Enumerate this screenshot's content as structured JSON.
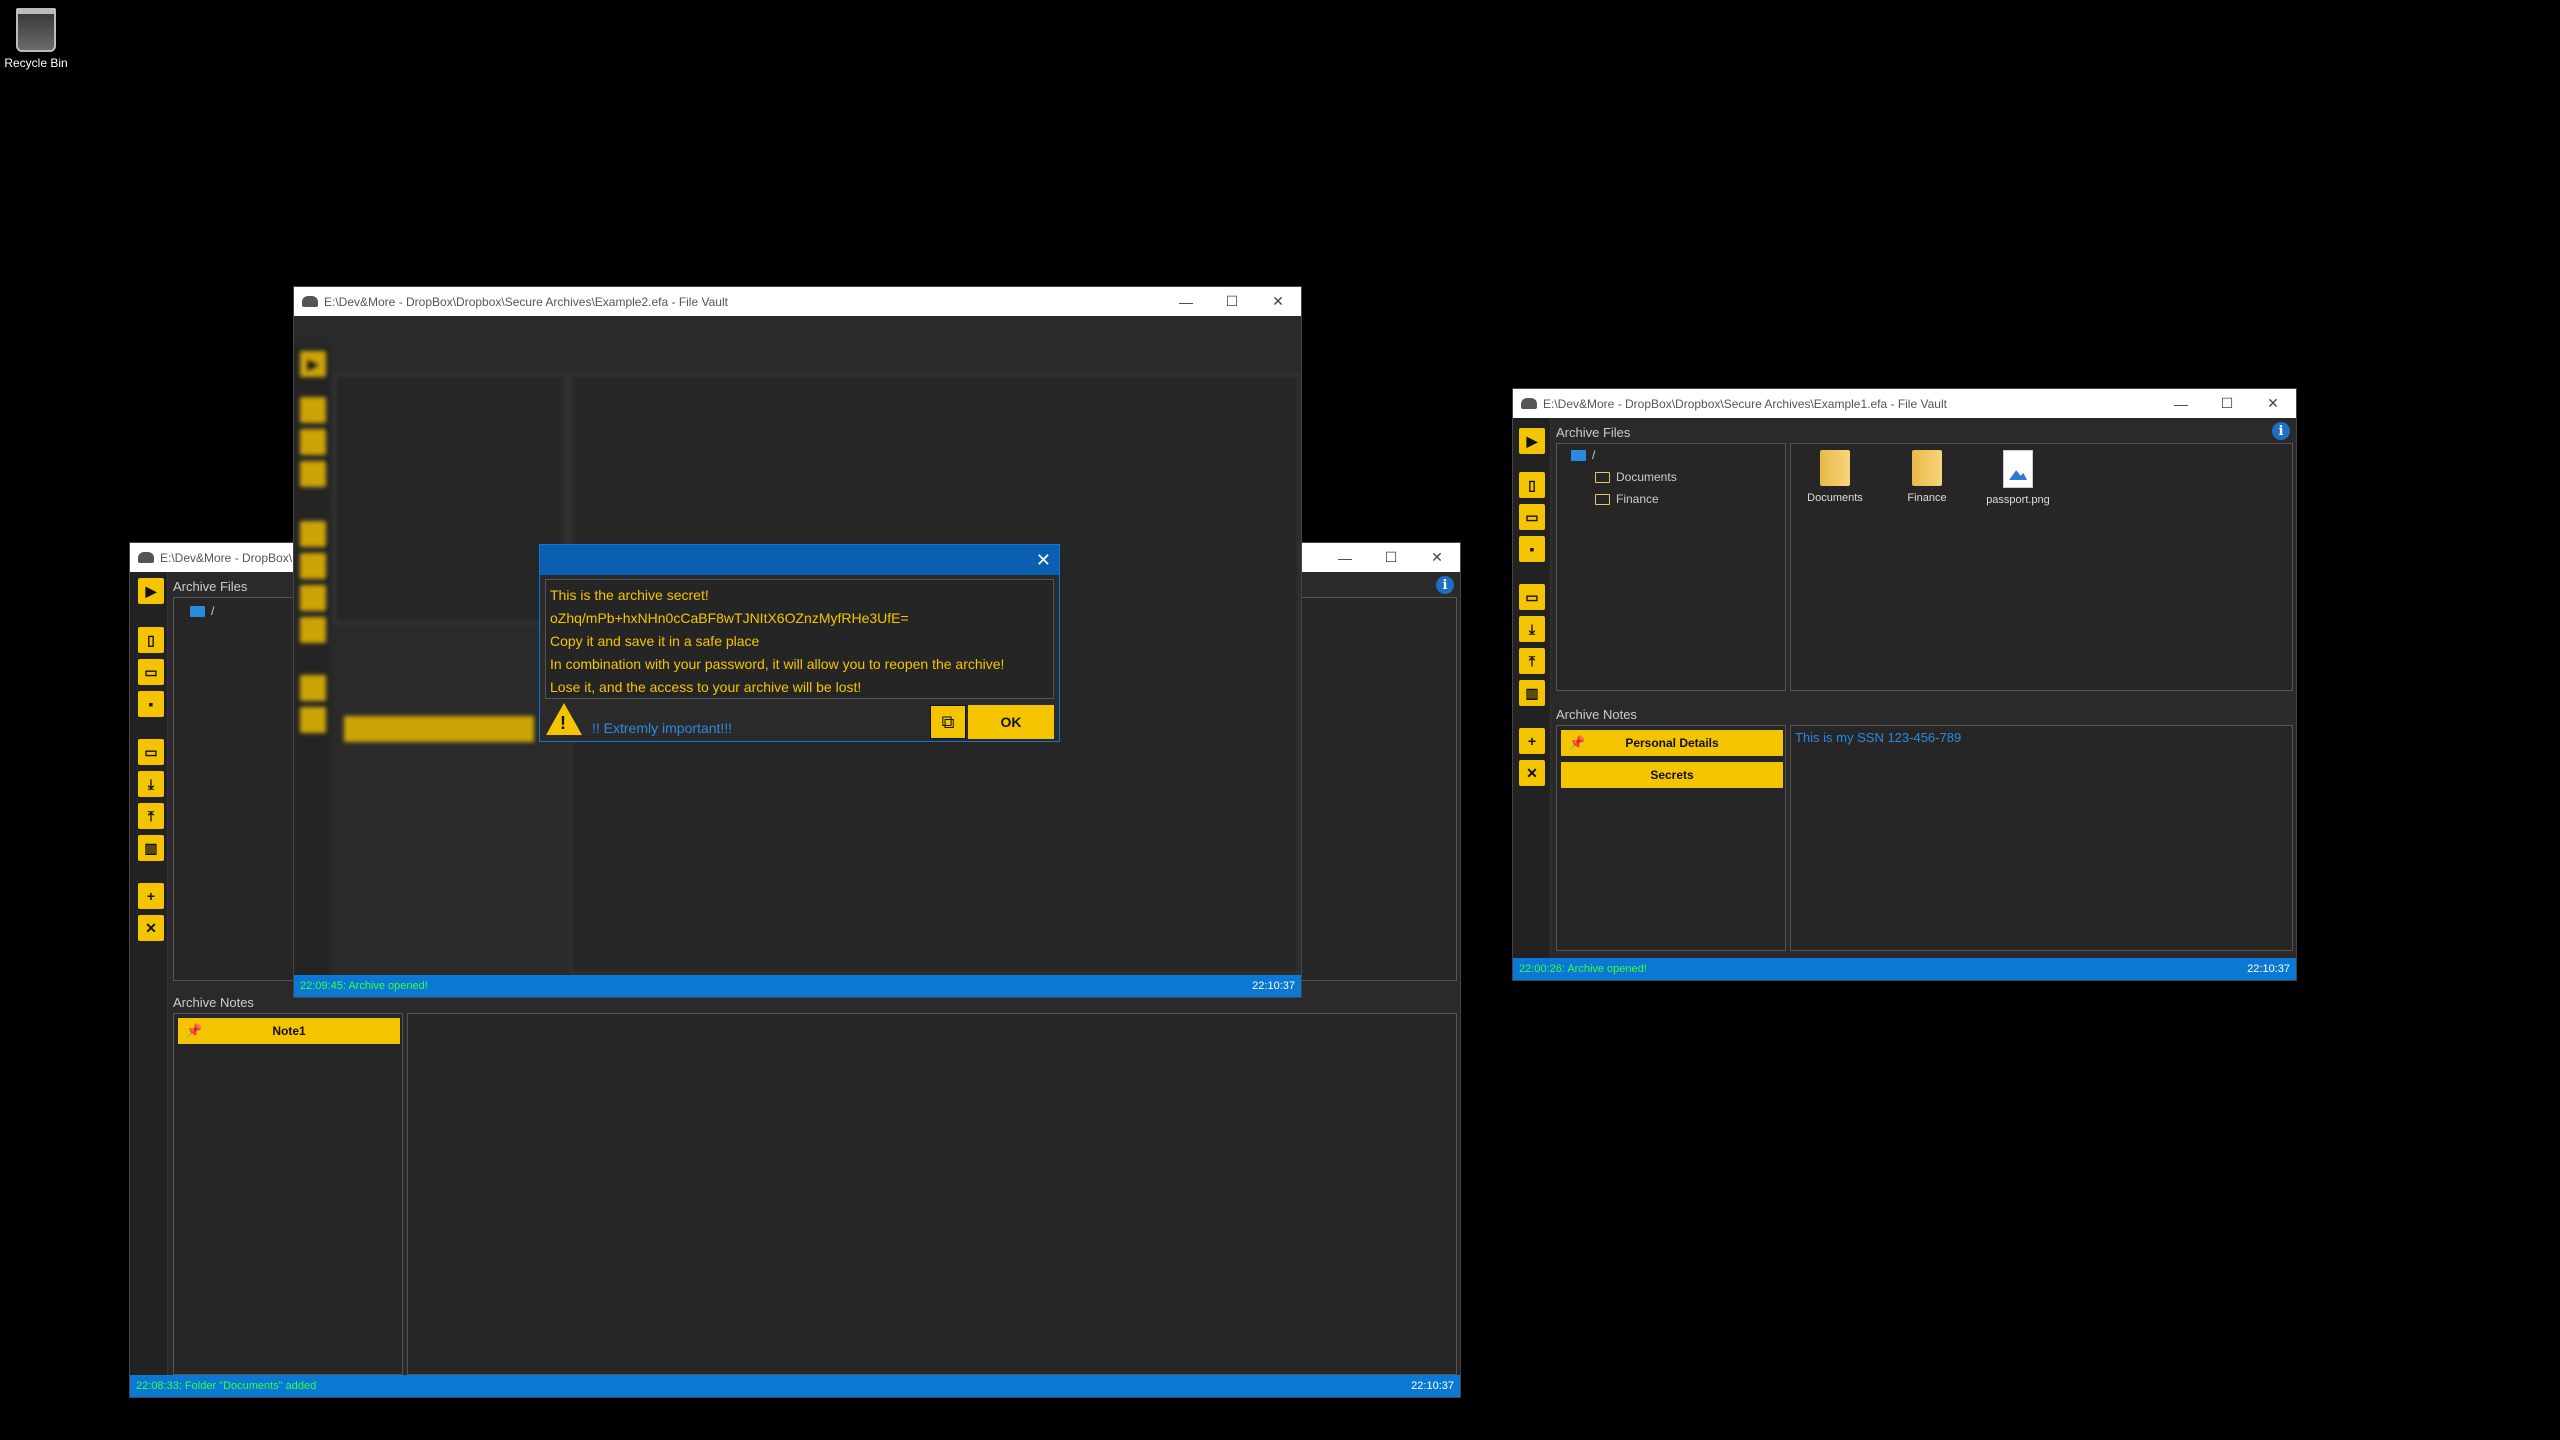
{
  "desktop": {
    "recycle_bin_label": "Recycle Bin"
  },
  "window_left": {
    "title": "E:\\Dev&More - DropBox\\",
    "files_label": "Archive Files",
    "root": "/",
    "notes_label": "Archive Notes",
    "notes": [
      "Note1"
    ],
    "status_msg": "22:08:33: Folder \"Documents\" added",
    "status_time": "22:10:37"
  },
  "window_middle": {
    "title": "E:\\Dev&More - DropBox\\Dropbox\\Secure Archives\\Example2.efa - File Vault",
    "status_msg": "22:09:45: Archive opened!",
    "status_time": "22:10:37"
  },
  "window_right": {
    "title": "E:\\Dev&More - DropBox\\Dropbox\\Secure Archives\\Example1.efa - File Vault",
    "files_label": "Archive Files",
    "root": "/",
    "tree": [
      "Documents",
      "Finance"
    ],
    "files": [
      {
        "name": "Documents",
        "icon": "folder-icon"
      },
      {
        "name": "Finance",
        "icon": "folder-icon"
      },
      {
        "name": "passport.png",
        "icon": "image-file-icon"
      }
    ],
    "notes_label": "Archive Notes",
    "notes": [
      "Personal Details",
      "Secrets"
    ],
    "note_text": "This is my SSN 123-456-789",
    "status_msg": "22:00:26: Archive opened!",
    "status_time": "22:10:37"
  },
  "dialog": {
    "lines": [
      "This is the archive secret!",
      "oZhq/mPb+hxNHn0cCaBF8wTJNItX6OZnzMyfRHe3UfE=",
      "Copy it and save it in a safe place",
      "In combination with your password, it will allow you to reopen the archive!",
      "Lose it, and the access to your archive will be lost!"
    ],
    "important": "!! Extremly important!!!",
    "ok_label": "OK"
  },
  "colors": {
    "accent": "#f5c400",
    "status_bar": "#0a78d4",
    "status_text": "#39ff3a",
    "info_blue": "#1e6fc4"
  }
}
